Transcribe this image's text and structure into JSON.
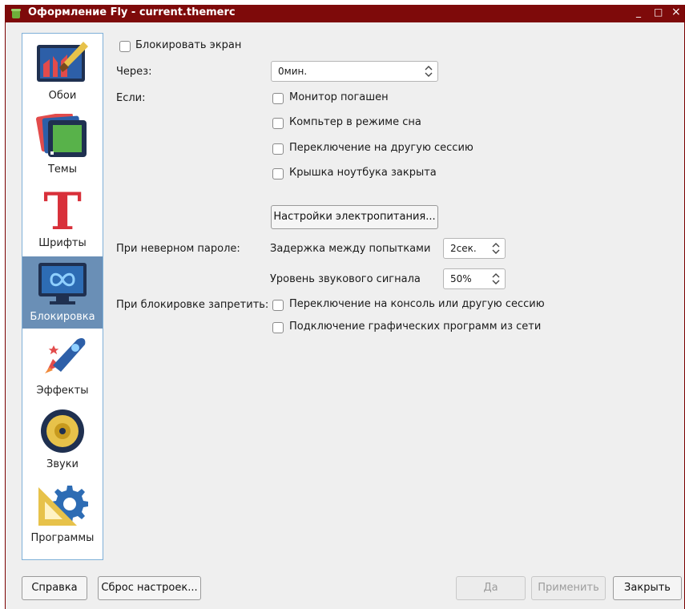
{
  "window": {
    "title": "Оформление Fly - current.themerc",
    "minimize": "_",
    "maximize": "□",
    "close": "×"
  },
  "sidebar": {
    "items": [
      {
        "label": "Обои",
        "icon": "wallpaper-icon"
      },
      {
        "label": "Темы",
        "icon": "themes-icon"
      },
      {
        "label": "Шрифты",
        "icon": "fonts-icon"
      },
      {
        "label": "Блокировка",
        "icon": "lock-screen-icon",
        "active": true
      },
      {
        "label": "Эффекты",
        "icon": "effects-icon"
      },
      {
        "label": "Звуки",
        "icon": "sounds-icon"
      },
      {
        "label": "Программы",
        "icon": "programs-icon"
      }
    ]
  },
  "lock": {
    "lock_screen_label": "Блокировать экран",
    "after_label": "Через:",
    "after_value": "0мин.",
    "if_label": "Если:",
    "if_options": [
      "Монитор погашен",
      "Компьтер в режиме сна",
      "Переключение на другую сессию",
      "Крышка ноутбука закрыта"
    ],
    "power_settings_button": "Настройки электропитания...",
    "wrong_password_label": "При неверном пароле:",
    "delay_label": "Задержка между попытками",
    "delay_value": "2сек.",
    "sound_label": "Уровень звукового сигнала",
    "sound_value": "50%",
    "forbid_label": "При блокировке запретить:",
    "forbid_options": [
      "Переключение на консоль или другую сессию",
      "Подключение графических программ из сети"
    ]
  },
  "footer": {
    "help": "Справка",
    "reset": "Сброс настроек...",
    "ok": "Да",
    "apply": "Применить",
    "close": "Закрыть"
  }
}
